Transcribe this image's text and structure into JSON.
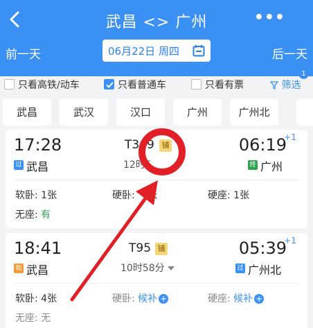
{
  "header": {
    "title": "武昌 <> 广州",
    "prev_day": "前一天",
    "next_day": "后一天",
    "date": "06月22日 周四"
  },
  "filters": {
    "high_speed": "只看高铁/动车",
    "normal": "只看普通车",
    "available": "只看有票",
    "filter_label": "筛选",
    "filter_badge": "1"
  },
  "stations": [
    "武昌",
    "武汉",
    "汉口",
    "广州",
    "广州北"
  ],
  "trains": [
    {
      "dep_time": "17:28",
      "dep_station": "武昌",
      "dep_tag": "过",
      "train_no": "T369",
      "berth": "铺",
      "duration": "12时5",
      "arr_time": "06:19",
      "arr_day": "+1",
      "arr_station": "广州",
      "arr_tag": "终",
      "seats": {
        "soft_sleeper": "软卧: 1张",
        "hard_sleeper": "硬卧: ",
        "hard_sleeper_tail": "张",
        "hard_seat": "硬座: 1张",
        "no_seat_label": "无座: ",
        "no_seat_value": "有"
      }
    },
    {
      "dep_time": "18:41",
      "dep_station": "武昌",
      "dep_tag": "始",
      "train_no": "T95",
      "berth": "铺",
      "duration": "10时58分",
      "arr_time": "05:39",
      "arr_day": "+1",
      "arr_station": "广州北",
      "arr_tag": "过",
      "seats": {
        "soft_sleeper": "软卧: 4张",
        "hard_sleeper_label": "硬卧: ",
        "hard_sleeper_value": "候补",
        "hard_seat_label": "硬座: ",
        "hard_seat_value": "候补",
        "no_seat": "无座: 无"
      }
    }
  ],
  "colors": {
    "brand": "#3b90f4",
    "annotation": "#e01f26",
    "berth_tag": "#f6d87a",
    "available_green": "#2ea44f"
  }
}
